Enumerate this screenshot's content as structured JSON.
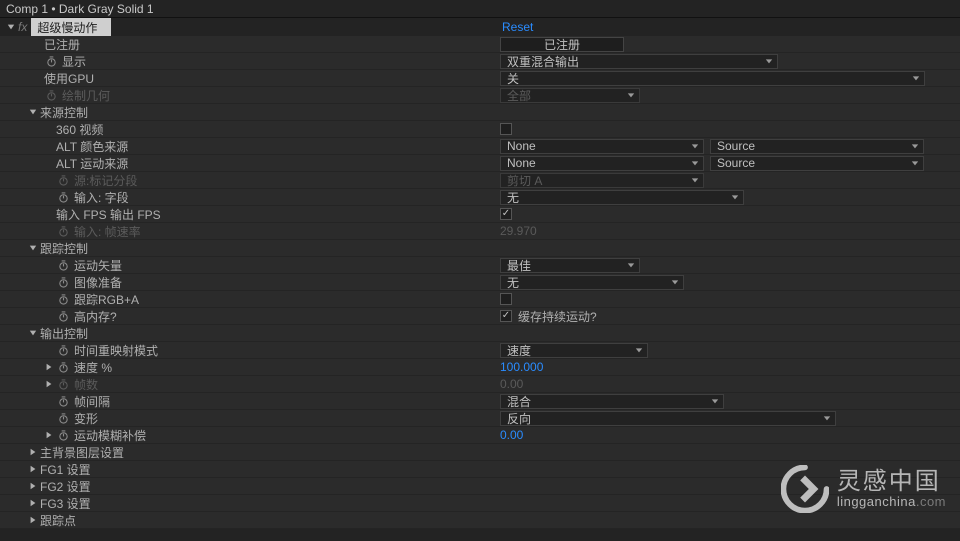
{
  "header": {
    "title": "Comp 1 • Dark Gray Solid 1"
  },
  "effect": {
    "name": "超级慢动作",
    "reset": "Reset"
  },
  "rows": {
    "registered": {
      "label": "已注册",
      "value": "已注册"
    },
    "display": {
      "label": "显示",
      "value": "双重混合输出"
    },
    "useGpu": {
      "label": "使用GPU",
      "value": "关"
    },
    "drawGeom": {
      "label": "绘制几何",
      "value": "全部"
    },
    "srcCtrl": {
      "label": "来源控制"
    },
    "video360": {
      "label": "360 视频"
    },
    "altColor": {
      "label": "ALT 颜色来源",
      "left": "None",
      "right": "Source"
    },
    "altMotion": {
      "label": "ALT 运动来源",
      "left": "None",
      "right": "Source"
    },
    "srcMarker": {
      "label": "源:标记分段",
      "value": "剪切 A"
    },
    "inputField": {
      "label": "输入: 字段",
      "value": "无"
    },
    "inFpsOutFps": {
      "label": "输入 FPS 输出 FPS"
    },
    "inFrameRate": {
      "label": "输入: 帧速率",
      "value": "29.970"
    },
    "trackCtrl": {
      "label": "跟踪控制"
    },
    "motionVec": {
      "label": "运动矢量",
      "value": "最佳"
    },
    "imagePrep": {
      "label": "图像准备",
      "value": "无"
    },
    "trackRgba": {
      "label": "跟踪RGB+A"
    },
    "highMem": {
      "label": "高内存?",
      "checkLabel": "缓存持续运动?"
    },
    "outCtrl": {
      "label": "输出控制"
    },
    "timeRemap": {
      "label": "时间重映射模式",
      "value": "速度"
    },
    "speedPct": {
      "label": "速度 %",
      "value": "100.000"
    },
    "frameCount": {
      "label": "帧数",
      "value": "0.00"
    },
    "frameGap": {
      "label": "帧间隔",
      "value": "混合"
    },
    "deform": {
      "label": "变形",
      "value": "反向"
    },
    "mblurComp": {
      "label": "运动模糊补偿",
      "value": "0.00"
    },
    "bgLayer": {
      "label": "主背景图层设置"
    },
    "fg1": {
      "label": "FG1 设置"
    },
    "fg2": {
      "label": "FG2 设置"
    },
    "fg3": {
      "label": "FG3 设置"
    },
    "trackPt": {
      "label": "跟踪点"
    }
  },
  "watermark": {
    "cn": "灵感中国",
    "en_main": "lingganchina",
    "en_suffix": ".com"
  }
}
